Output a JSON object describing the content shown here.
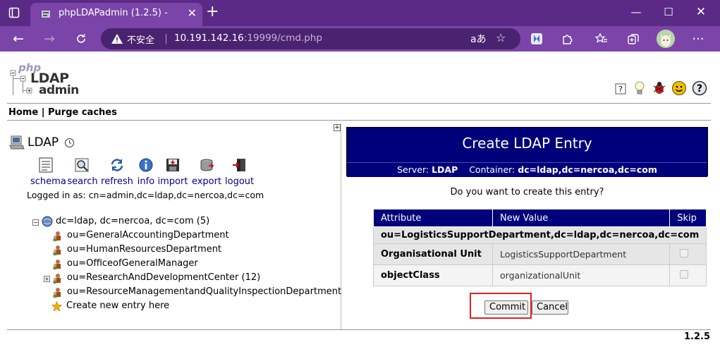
{
  "browser": {
    "tab_title": "phpLDAPadmin (1.2.5) -",
    "security_label": "不安全",
    "url_host": "10.191.142.16",
    "url_rest": ":19999/cmd.php",
    "omni_read_aloud": "aあ"
  },
  "header": {
    "logo_php": "php",
    "logo_ldap": "LDAP",
    "logo_admin": "admin"
  },
  "menu": {
    "home": "Home",
    "separator": "|",
    "purge": "Purge caches"
  },
  "server": {
    "name": "LDAP",
    "logged_in": "Logged in as: cn=admin,dc=ldap,dc=nercoa,dc=com"
  },
  "actions": [
    {
      "label": "schema",
      "icon": "schema-icon"
    },
    {
      "label": "search",
      "icon": "search-icon"
    },
    {
      "label": "refresh",
      "icon": "refresh-icon"
    },
    {
      "label": "info",
      "icon": "info-icon"
    },
    {
      "label": "import",
      "icon": "import-icon"
    },
    {
      "label": "export",
      "icon": "export-icon"
    },
    {
      "label": "logout",
      "icon": "logout-icon"
    }
  ],
  "tree": {
    "root": "dc=ldap, dc=nercoa, dc=com (5)",
    "items": [
      {
        "label": "ou=GeneralAccountingDepartment"
      },
      {
        "label": "ou=HumanResourcesDepartment"
      },
      {
        "label": "ou=OfficeofGeneralManager"
      },
      {
        "label": "ou=ResearchAndDevelopmentCenter (12)"
      },
      {
        "label": "ou=ResourceManagementandQualityInspectionDepartment"
      },
      {
        "label": "Create new entry here"
      }
    ]
  },
  "create": {
    "title": "Create LDAP Entry",
    "server_label": "Server:",
    "server_value": "LDAP",
    "container_label": "Container:",
    "container_value": "dc=ldap,dc=nercoa,dc=com",
    "question": "Do you want to create this entry?",
    "columns": [
      "Attribute",
      "New Value",
      "Skip"
    ],
    "dn": "ou=LogisticsSupportDepartment,dc=ldap,dc=nercoa,dc=com",
    "rows": [
      {
        "attribute": "Organisational Unit",
        "value": "LogisticsSupportDepartment"
      },
      {
        "attribute": "objectClass",
        "value": "organizationalUnit"
      }
    ],
    "commit": "Commit",
    "cancel": "Cancel"
  },
  "footer": {
    "version": "1.2.5"
  },
  "colors": {
    "chrome": "#5b2a86",
    "toolbar": "#7a44a8",
    "header_bg": "#00007a",
    "link": "#00008b",
    "highlight": "#e02020"
  }
}
